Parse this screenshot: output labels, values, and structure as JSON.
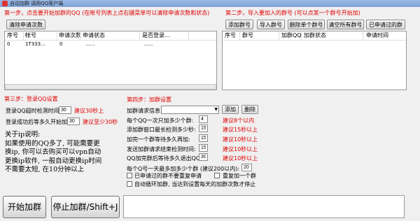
{
  "window": {
    "title": "自动加群 调用QQ客户端"
  },
  "step1": {
    "title": "第一步，点击要开始加群的QQ (在帐号列表上点右键菜单可以清除申请次数和状态)",
    "clear_button": "清除申请次数",
    "columns": [
      "序号",
      "帐号",
      "申请次数",
      "申请状态",
      "是否登录..."
    ],
    "rows": [
      [
        "0",
        "1T333...",
        "0",
        "......",
        "......"
      ]
    ]
  },
  "step2": {
    "title": "第二步，导入要加入的群号 (可以点某一个群号开始加)",
    "buttons": [
      "添加群号",
      "导入群号",
      "删除单个群号",
      "清空所有群号",
      "已申请过的群"
    ],
    "columns": [
      "序号",
      "群号",
      "加群QQ",
      "加群状态",
      "申请时间"
    ]
  },
  "step3": {
    "title": "第三步：登录QQ设置",
    "login_timeout_label": "登录QQ超时检测时间:",
    "login_timeout_value": "30",
    "login_timeout_hint": "建议30秒上",
    "wait_after_login_label": "登录成功后等多久开始加:",
    "wait_after_login_value": "30",
    "wait_after_login_hint": "建议至少30秒",
    "ip_note": "关于ip说明:\n如果使用的QQ多了, 可能需要更\n换ip, 你可以去购买可以vpn自动\n更换ip软件, 一般自动更换ip时间\n不需要太短, 在10分钟以上"
  },
  "step4": {
    "title": "第四步：加群设置",
    "request_info_label": "加群请求信息:",
    "add_button": "添加",
    "delete_button": "删除",
    "settings": [
      {
        "label": "每个QQ一次只加多少个群:",
        "value": "4",
        "hint": "建议8个以内"
      },
      {
        "label": "添加群窗口最长检测多少秒:",
        "value": "15",
        "hint": "建议15秒以上"
      },
      {
        "label": "加完一个群等待多久再加:",
        "value": "15",
        "hint": "建议10秒以上"
      },
      {
        "label": "发送加群请求结束检测时间:",
        "value": "15",
        "hint": "建议10秒以上"
      },
      {
        "label": "QQ加完群后等待多久退出QQ:",
        "value": "30",
        "hint": "建议10秒以上"
      }
    ],
    "daily_limit_label": "每个Q号一天最多加多少个群 (建议200以内):",
    "daily_limit_value": "20",
    "checkbox_no_repeat": "已申请过的群不要重复申请",
    "checkbox_repeat_one": "重复加一个群",
    "checkbox_auto_loop": "自动循环加群, 当达到设置每天的加群次数才停止"
  },
  "actions": {
    "start": "开始加群",
    "stop": "停止加群/Shift+J"
  }
}
